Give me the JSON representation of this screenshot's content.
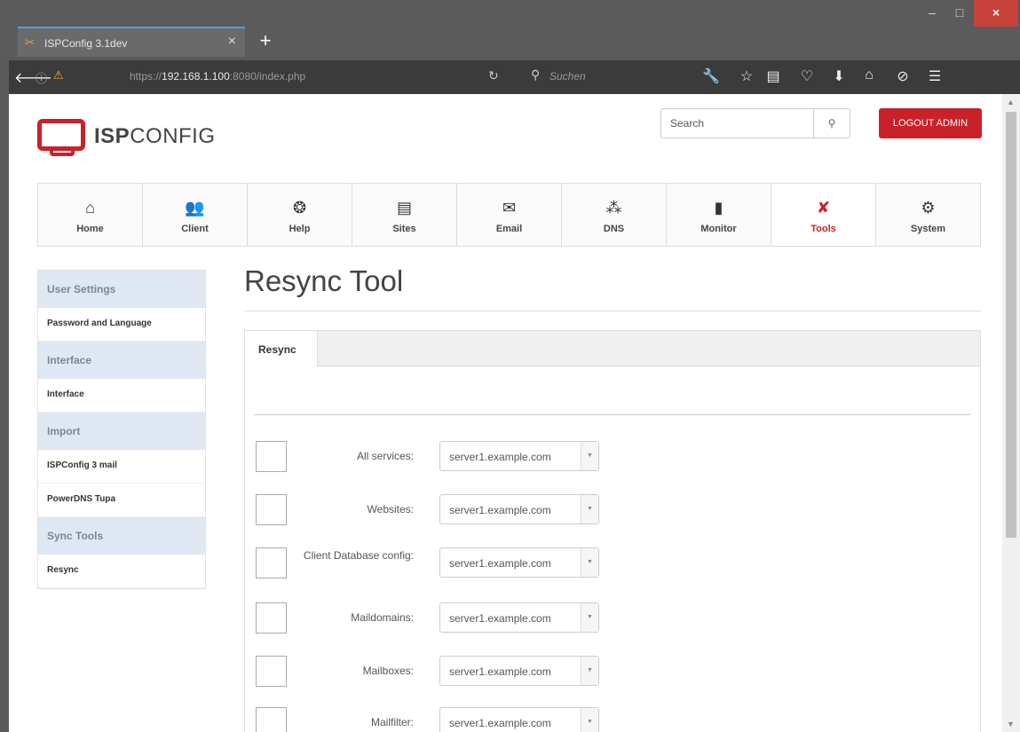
{
  "browser": {
    "tab_title": "ISPConfig 3.1dev",
    "tab_close": "×",
    "new_tab": "+",
    "url_prefix": "https://",
    "url_host": "192.168.1.100",
    "url_suffix": ":8080/index.php",
    "search_placeholder": "Suchen",
    "win_min": "–",
    "win_max": "□",
    "win_close": "×"
  },
  "header": {
    "logo_bold": "ISP",
    "logo_light": "CONFIG",
    "search_placeholder": "Search",
    "logout_label": "LOGOUT ADMIN"
  },
  "main_nav": [
    {
      "label": "Home",
      "icon": "home-icon"
    },
    {
      "label": "Client",
      "icon": "users-icon"
    },
    {
      "label": "Help",
      "icon": "lifebuoy-icon"
    },
    {
      "label": "Sites",
      "icon": "sites-icon"
    },
    {
      "label": "Email",
      "icon": "email-icon"
    },
    {
      "label": "DNS",
      "icon": "dns-icon"
    },
    {
      "label": "Monitor",
      "icon": "monitor-icon"
    },
    {
      "label": "Tools",
      "icon": "tools-icon",
      "active": true
    },
    {
      "label": "System",
      "icon": "gear-icon"
    }
  ],
  "sidebar": {
    "groups": [
      {
        "title": "User Settings",
        "items": [
          "Password and Language"
        ]
      },
      {
        "title": "Interface",
        "items": [
          "Interface"
        ]
      },
      {
        "title": "Import",
        "items": [
          "ISPConfig 3 mail",
          "PowerDNS Tupa"
        ]
      },
      {
        "title": "Sync Tools",
        "items": [
          "Resync"
        ]
      }
    ]
  },
  "page": {
    "title": "Resync Tool",
    "tab_label": "Resync"
  },
  "form": {
    "rows": [
      {
        "label": "All services:",
        "value": "server1.example.com"
      },
      {
        "label": "Websites:",
        "value": "server1.example.com"
      },
      {
        "label": "Client Database config:",
        "value": "server1.example.com"
      },
      {
        "label": "Maildomains:",
        "value": "server1.example.com"
      },
      {
        "label": "Mailboxes:",
        "value": "server1.example.com"
      },
      {
        "label": "Mailfilter:",
        "value": "server1.example.com"
      }
    ]
  },
  "colors": {
    "accent": "#c9212a",
    "sidebar_group_bg": "#dfe7f2"
  }
}
